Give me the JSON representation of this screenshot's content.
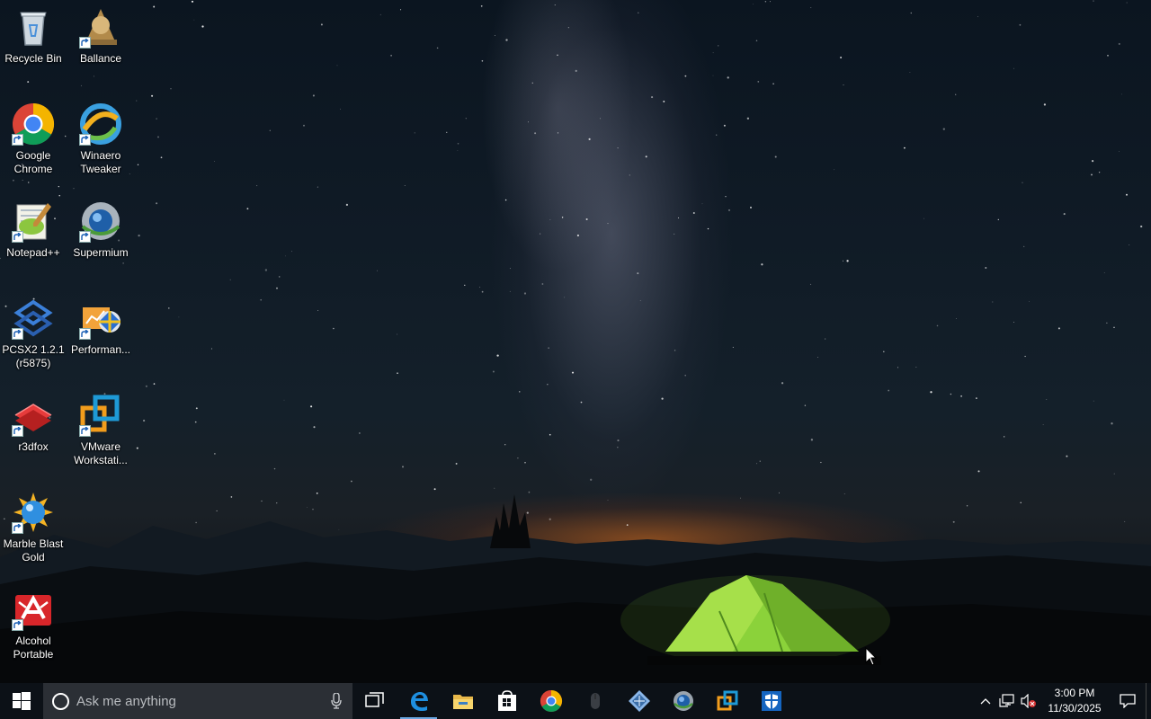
{
  "desktop": {
    "icons": [
      {
        "label": "Recycle Bin",
        "icon": "recycle-bin-icon",
        "shortcut": false
      },
      {
        "label": "Ballance",
        "icon": "ballance-icon",
        "shortcut": true
      },
      {
        "label": "Google Chrome",
        "icon": "chrome-icon",
        "shortcut": true
      },
      {
        "label": "Winaero Tweaker",
        "icon": "winaero-tweaker-icon",
        "shortcut": true
      },
      {
        "label": "Notepad++",
        "icon": "notepad-plus-plus-icon",
        "shortcut": true
      },
      {
        "label": "Supermium",
        "icon": "supermium-icon",
        "shortcut": true
      },
      {
        "label": "PCSX2 1.2.1 (r5875)",
        "icon": "pcsx2-icon",
        "shortcut": true
      },
      {
        "label": "Performan...",
        "icon": "performance-icon",
        "shortcut": true
      },
      {
        "label": "r3dfox",
        "icon": "r3dfox-icon",
        "shortcut": true
      },
      {
        "label": "VMware Workstati...",
        "icon": "vmware-icon",
        "shortcut": true
      },
      {
        "label": "Marble Blast Gold",
        "icon": "marble-blast-icon",
        "shortcut": true
      },
      {
        "label": "Alcohol Portable",
        "icon": "alcohol-icon",
        "shortcut": true
      }
    ]
  },
  "taskbar": {
    "search_placeholder": "Ask me anything",
    "pinned_apps": [
      {
        "name": "task-view",
        "icon": "task-view-icon"
      },
      {
        "name": "edge",
        "icon": "edge-icon",
        "active": true
      },
      {
        "name": "file-explorer",
        "icon": "folder-icon"
      },
      {
        "name": "store",
        "icon": "store-icon"
      },
      {
        "name": "chrome",
        "icon": "chrome-icon"
      },
      {
        "name": "mouse-app",
        "icon": "mouse-icon"
      },
      {
        "name": "network-app",
        "icon": "network-diamond-icon"
      },
      {
        "name": "supermium",
        "icon": "supermium-icon"
      },
      {
        "name": "vmware",
        "icon": "vmware-icon"
      },
      {
        "name": "defender",
        "icon": "shield-icon"
      }
    ],
    "clock": {
      "time": "3:00 PM",
      "date": "11/30/2025"
    }
  },
  "colors": {
    "taskbar_bg": "#0c1117",
    "search_bg": "#2b2f35",
    "accent": "#6aa6e0",
    "tent": "#8bd23a"
  }
}
